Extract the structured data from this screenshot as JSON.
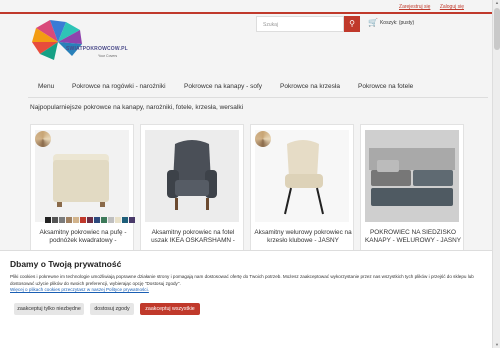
{
  "colors": {
    "accent": "#c0392b",
    "bg": "#f4f4f4"
  },
  "header": {
    "register": "Zarejestruj się",
    "login": "Zaloguj się",
    "logo_text": "SWIATPOKROWCOW.PL",
    "logo_sub": "Your Covers",
    "search_placeholder": "Szukaj",
    "cart_label": "Koszyk: (pusty)"
  },
  "nav": {
    "items": [
      "Menu",
      "Pokrowce na rogówki - narożniki",
      "Pokrowce na kanapy - sofy",
      "Pokrowce na krzesła",
      "Pokrowce na fotele"
    ]
  },
  "main": {
    "heading": "Najpopularniejsze pokrowce na kanapy, narożniki, fotele, krzesła, wersalki",
    "cards": [
      {
        "title": "Aksamitny pokrowiec na pufę - podnóżek kwadratowy -"
      },
      {
        "title": "Aksamitny pokrowiec na fotel uszak IKEA OSKARSHAMN -"
      },
      {
        "title": "Aksamitny welurowy pokrowiec na krzesło klubowe - JASNY"
      },
      {
        "title": "POKROWIEC NA SIEDZISKO KANAPY - WELUROWY - JASNY"
      }
    ]
  },
  "cookie": {
    "title": "Dbamy o Twoją prywatność",
    "body": "Pliki cookies i pokrewne im technologie umożliwiają poprawne działanie strony i pomagają nam dostosować ofertę do Twoich potrzeb. Możesz zaakceptować wykorzystanie przez nas wszystkich tych plików i przejść do sklepu lub dostosować użycie plików do swoich preferencji, wybierając opcję \"Dostosuj zgody\".",
    "link": "Więcej o plikach cookies przeczytasz w naszej Polityce prywatności.",
    "btn_necessary": "zaakceptuj tylko niezbędne",
    "btn_custom": "dostosuj zgody",
    "btn_all": "zaakceptuj wszystkie"
  }
}
